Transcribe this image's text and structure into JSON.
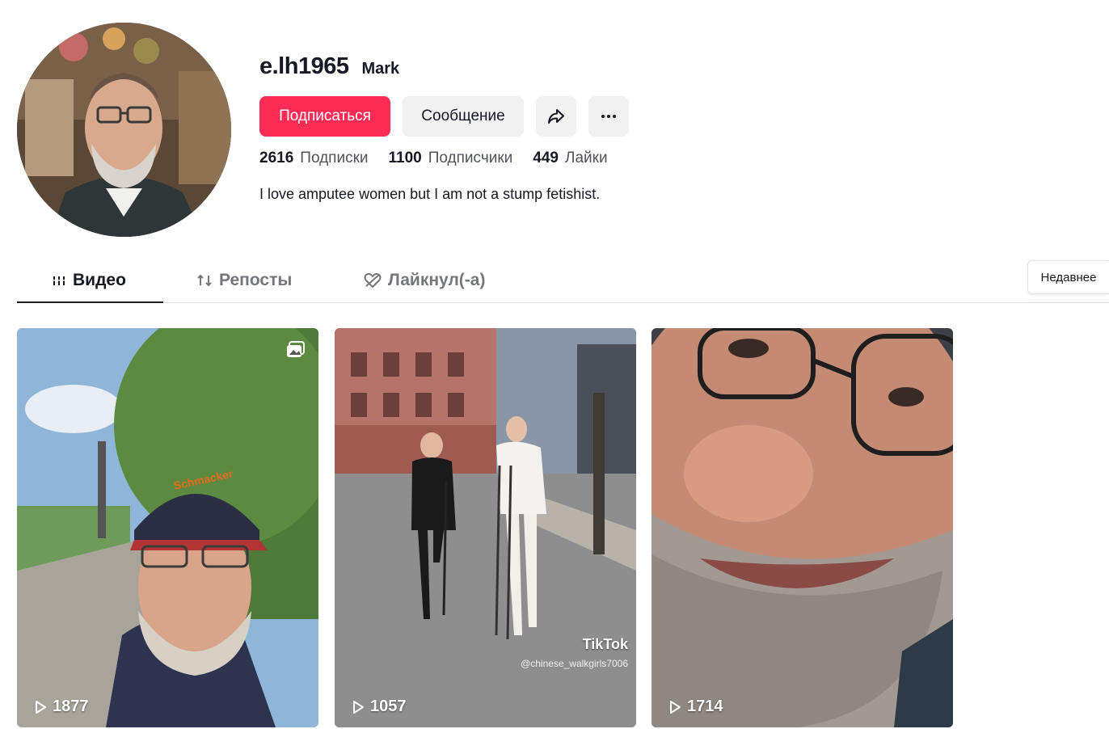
{
  "profile": {
    "username": "e.lh1965",
    "nickname": "Mark",
    "follow_label": "Подписаться",
    "message_label": "Сообщение",
    "share_icon": "share-icon",
    "more_icon": "more-icon",
    "bio": "I love amputee women but I am not a stump fetishist."
  },
  "stats": [
    {
      "value": "2616",
      "label": "Подписки"
    },
    {
      "value": "1100",
      "label": "Подписчики"
    },
    {
      "value": "449",
      "label": "Лайки"
    }
  ],
  "tabs": [
    {
      "label": "Видео",
      "icon": "grid-icon",
      "active": true
    },
    {
      "label": "Репосты",
      "icon": "repost-icon",
      "active": false
    },
    {
      "label": "Лайкнул(-а)",
      "icon": "liked-heart-icon",
      "active": false
    }
  ],
  "sort": {
    "label": "Недавнее"
  },
  "videos": [
    {
      "views": "1877",
      "photo_badge": true
    },
    {
      "views": "1057",
      "watermark": "TikTok",
      "handle": "@chinese_walkgirls7006"
    },
    {
      "views": "1714"
    }
  ],
  "colors": {
    "accent": "#fe2c55",
    "text": "#161823",
    "muted": "#75767c",
    "button_bg": "#f1f1f2"
  }
}
